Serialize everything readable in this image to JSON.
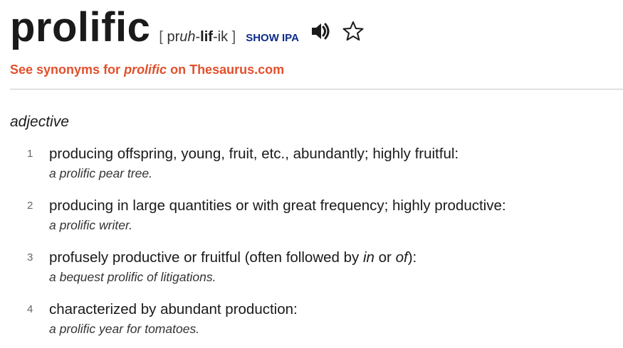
{
  "entry": {
    "headword": "prolific",
    "pronunciation": {
      "open_bracket": "[",
      "part1": " pr",
      "part1_italic": "uh",
      "sep1": "-",
      "part2_bold": "lif",
      "sep2": "-",
      "part3": "ik ",
      "close_bracket": "]"
    },
    "show_ipa_label": "SHOW IPA",
    "audio_icon": "speaker-icon",
    "favorite_icon": "star-outline-icon",
    "synonyms": {
      "prefix": "See synonyms for ",
      "word": "prolific",
      "suffix": " on Thesaurus.com"
    },
    "accent_color": "#e1502c",
    "link_color": "#0d2c8a"
  },
  "part_of_speech": "adjective",
  "definitions": [
    {
      "number": "1",
      "text": "producing offspring, young, fruit, etc., abundantly; highly fruitful:",
      "example": "a prolific pear tree."
    },
    {
      "number": "2",
      "text": "producing in large quantities or with great frequency; highly productive:",
      "example": "a prolific writer."
    },
    {
      "number": "3",
      "text_before": "profusely productive or fruitful (often followed by ",
      "text_italic_1": "in",
      "text_middle": " or ",
      "text_italic_2": "of",
      "text_after": "):",
      "example": "a bequest prolific of litigations."
    },
    {
      "number": "4",
      "text": "characterized by abundant production:",
      "example": "a prolific year for tomatoes."
    }
  ]
}
